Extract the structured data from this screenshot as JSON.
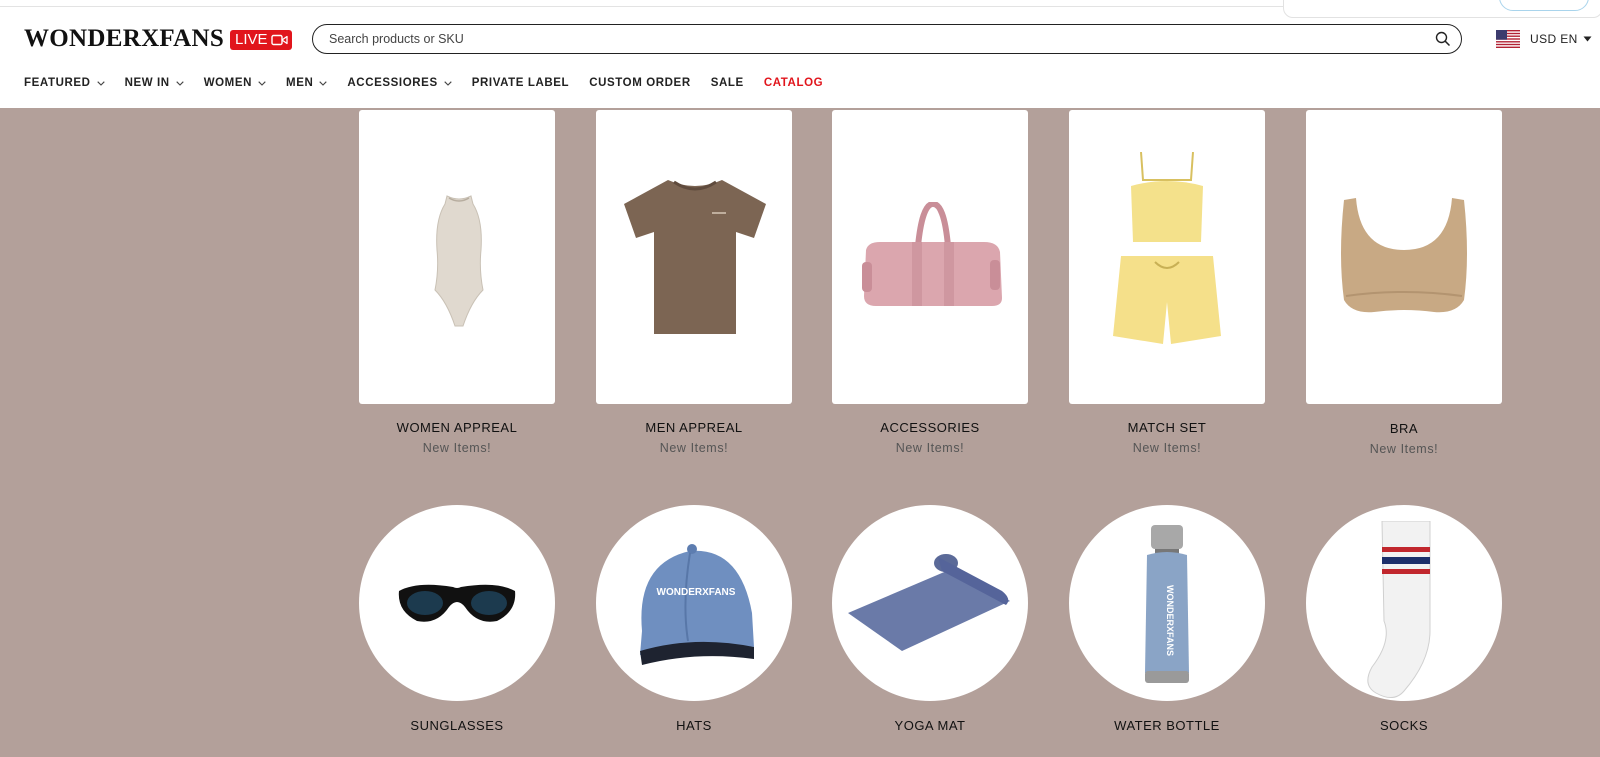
{
  "header": {
    "logo": "WONDERXFANS",
    "live_label": "LIVE",
    "search_placeholder": "Search products or SKU",
    "locale": "USD EN"
  },
  "nav": [
    {
      "label": "FEATURED",
      "has_dropdown": true
    },
    {
      "label": "NEW IN",
      "has_dropdown": true
    },
    {
      "label": "WOMEN",
      "has_dropdown": true
    },
    {
      "label": "MEN",
      "has_dropdown": true
    },
    {
      "label": "ACCESSIORES",
      "has_dropdown": true
    },
    {
      "label": "PRIVATE LABEL",
      "has_dropdown": false
    },
    {
      "label": "CUSTOM ORDER",
      "has_dropdown": false
    },
    {
      "label": "SALE",
      "has_dropdown": false
    },
    {
      "label": "CATALOG",
      "has_dropdown": false,
      "color": "#e1151c"
    }
  ],
  "categories": [
    {
      "title": "WOMEN APPREAL",
      "subtitle": "New Items!",
      "icon": "bodysuit-image"
    },
    {
      "title": "MEN APPREAL",
      "subtitle": "New Items!",
      "icon": "tshirt-image"
    },
    {
      "title": "ACCESSORIES",
      "subtitle": "New Items!",
      "icon": "duffel-bag-image"
    },
    {
      "title": "MATCH SET",
      "subtitle": "New Items!",
      "icon": "match-set-image"
    },
    {
      "title": "BRA",
      "subtitle": "New Items!",
      "icon": "bra-image"
    }
  ],
  "accessories": [
    {
      "title": "SUNGLASSES",
      "icon": "sunglasses-image"
    },
    {
      "title": "HATS",
      "icon": "cap-image",
      "print": "WONDERXFANS"
    },
    {
      "title": "YOGA MAT",
      "icon": "yoga-mat-image"
    },
    {
      "title": "WATER BOTTLE",
      "icon": "bottle-image",
      "print": "WONDERXFANS"
    },
    {
      "title": "SOCKS",
      "icon": "socks-image"
    }
  ],
  "colors": {
    "background": "#b3a09a",
    "accent": "#e1151c"
  }
}
